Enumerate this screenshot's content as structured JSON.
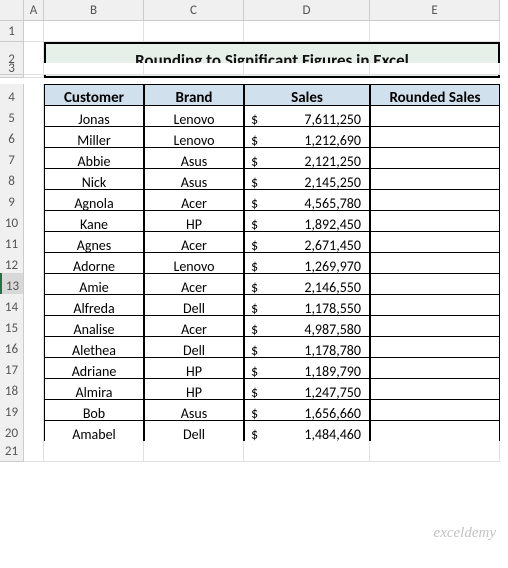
{
  "columns": [
    "A",
    "B",
    "C",
    "D",
    "E"
  ],
  "rows": [
    "1",
    "2",
    "3",
    "4",
    "5",
    "6",
    "7",
    "8",
    "9",
    "10",
    "11",
    "12",
    "13",
    "14",
    "15",
    "16",
    "17",
    "18",
    "19",
    "20",
    "21"
  ],
  "selected_row": "13",
  "title": "Rounding to Significant Figures in Excel",
  "headers": {
    "customer": "Customer",
    "brand": "Brand",
    "sales": "Sales",
    "rounded": "Rounded Sales"
  },
  "currency_symbol": "$",
  "data": [
    {
      "customer": "Jonas",
      "brand": "Lenovo",
      "sales": "7,611,250"
    },
    {
      "customer": "Miller",
      "brand": "Lenovo",
      "sales": "1,212,690"
    },
    {
      "customer": "Abbie",
      "brand": "Asus",
      "sales": "2,121,250"
    },
    {
      "customer": "Nick",
      "brand": "Asus",
      "sales": "2,145,250"
    },
    {
      "customer": "Agnola",
      "brand": "Acer",
      "sales": "4,565,780"
    },
    {
      "customer": "Kane",
      "brand": "HP",
      "sales": "1,892,450"
    },
    {
      "customer": "Agnes",
      "brand": "Acer",
      "sales": "2,671,450"
    },
    {
      "customer": "Adorne",
      "brand": "Lenovo",
      "sales": "1,269,970"
    },
    {
      "customer": "Amie",
      "brand": "Acer",
      "sales": "2,146,550"
    },
    {
      "customer": "Alfreda",
      "brand": "Dell",
      "sales": "1,178,550"
    },
    {
      "customer": "Analise",
      "brand": "Acer",
      "sales": "4,987,580"
    },
    {
      "customer": "Alethea",
      "brand": "Dell",
      "sales": "1,178,780"
    },
    {
      "customer": "Adriane",
      "brand": "HP",
      "sales": "1,189,790"
    },
    {
      "customer": "Almira",
      "brand": "HP",
      "sales": "1,247,750"
    },
    {
      "customer": "Bob",
      "brand": "Asus",
      "sales": "1,656,660"
    },
    {
      "customer": "Amabel",
      "brand": "Dell",
      "sales": "1,484,460"
    }
  ],
  "watermark": "exceldemy"
}
